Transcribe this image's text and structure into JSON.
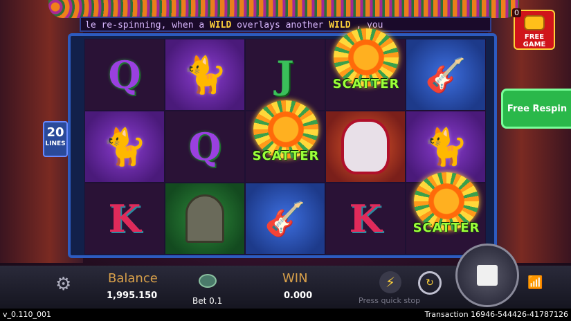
{
  "ticker": {
    "pre": "le re-spinning, when a ",
    "w1": "WILD",
    "mid": " overlays another ",
    "w2": "WILD",
    "post": " , you"
  },
  "lines": {
    "count": "20",
    "label": "LINES"
  },
  "free_game": {
    "count": "0",
    "label": "FREE GAME"
  },
  "free_respin": "Free Respin",
  "reels": [
    [
      {
        "type": "letter",
        "text": "Q",
        "bg": "dark"
      },
      {
        "type": "cat",
        "bg": "purple"
      },
      {
        "type": "letter",
        "text": "K",
        "bg": "dark"
      }
    ],
    [
      {
        "type": "cat",
        "bg": "purple"
      },
      {
        "type": "letter",
        "text": "Q",
        "bg": "dark"
      },
      {
        "type": "tombstone",
        "bg": "green"
      }
    ],
    [
      {
        "type": "letter",
        "text": "J",
        "bg": "dark"
      },
      {
        "type": "scatter",
        "text": "SCATTER",
        "bg": "dark"
      },
      {
        "type": "guitar",
        "bg": "blue"
      }
    ],
    [
      {
        "type": "scatter",
        "text": "SCATTER",
        "bg": "dark"
      },
      {
        "type": "catrina",
        "bg": "orange"
      },
      {
        "type": "letter",
        "text": "K",
        "bg": "dark"
      }
    ],
    [
      {
        "type": "guitar",
        "bg": "blue"
      },
      {
        "type": "cat",
        "bg": "purple"
      },
      {
        "type": "scatter",
        "text": "SCATTER",
        "bg": "dark"
      }
    ]
  ],
  "bottom": {
    "balance_label": "Balance",
    "balance_value": "1,995.150",
    "bet_label": "Bet 0.1",
    "win_label": "WIN",
    "win_value": "0.000",
    "press_stop": "Press quick stop"
  },
  "status": {
    "version": "v_0.110_001",
    "transaction": "Transaction 16946-544426-41787126"
  }
}
